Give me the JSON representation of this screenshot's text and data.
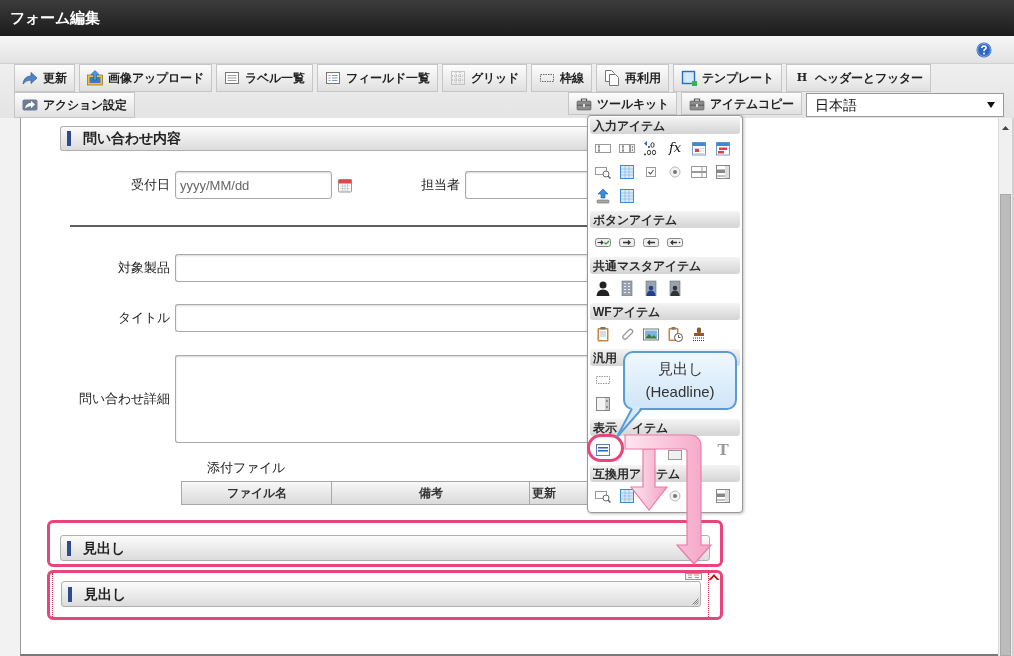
{
  "window": {
    "title": "フォーム編集"
  },
  "toolbar": {
    "row_1": [
      {
        "kind": "update",
        "label": "更新"
      },
      {
        "kind": "upload",
        "label": "画像アップロード"
      },
      {
        "kind": "labels",
        "label": "ラベル一覧"
      },
      {
        "kind": "fields",
        "label": "フィールド一覧"
      },
      {
        "kind": "grid",
        "label": "グリッド"
      },
      {
        "kind": "frame",
        "label": "枠線"
      },
      {
        "kind": "reuse",
        "label": "再利用"
      },
      {
        "kind": "template",
        "label": "テンプレート"
      },
      {
        "kind": "glyph",
        "glyph": "H",
        "label": "ヘッダーとフッター"
      }
    ],
    "row_2_left": [
      {
        "label": "アクション設定"
      }
    ],
    "row_2_right": [
      {
        "label": "ツールキット"
      },
      {
        "label": "アイテムコピー"
      }
    ],
    "language_select": {
      "value": "日本語"
    }
  },
  "form": {
    "section_title": "問い合わせ内容",
    "row_1": [
      {
        "kind": "date",
        "label": "受付日",
        "placeholder": "yyyy/MM/dd"
      },
      {
        "kind": "text",
        "label": "担当者"
      }
    ],
    "fields": [
      {
        "kind": "text",
        "label": "対象製品"
      },
      {
        "kind": "text",
        "label": "タイトル"
      },
      {
        "kind": "textarea",
        "label": "問い合わせ詳細"
      }
    ],
    "attachments": {
      "label": "添付ファイル",
      "columns": [
        "ファイル名",
        "備考",
        "更新"
      ]
    },
    "headlines": [
      {
        "label": "見出し",
        "framed": true,
        "selected": false
      },
      {
        "label": "見出し",
        "framed": true,
        "selected": true
      }
    ]
  },
  "toolkit_palette": {
    "sections": [
      {
        "title_parts": [
          "入力アイテム"
        ],
        "rows": [
          [
            {
              "kind": "text",
              "circled": false
            },
            {
              "kind": "text-button",
              "circled": false
            },
            {
              "kind": "decimal",
              "circled": false
            },
            {
              "kind": "formula",
              "glyph": "fx",
              "circled": false
            },
            {
              "kind": "calendar",
              "circled": false
            },
            {
              "kind": "calendar-range",
              "circled": false
            }
          ],
          [
            {
              "kind": "lookup",
              "circled": false
            },
            {
              "kind": "table",
              "circled": false
            },
            {
              "kind": "checkbox",
              "circled": false
            },
            {
              "kind": "radio",
              "circled": false
            },
            {
              "kind": "select",
              "circled": false
            },
            {
              "kind": "listbox",
              "circled": false
            }
          ],
          [
            {
              "kind": "upload",
              "circled": false
            },
            {
              "kind": "table",
              "circled": false
            }
          ]
        ]
      },
      {
        "title_parts": [
          "ボタンアイテム"
        ],
        "rows": [
          [
            {
              "kind": "button-check",
              "circled": false
            },
            {
              "kind": "button-next",
              "circled": false
            },
            {
              "kind": "button-back",
              "circled": false
            },
            {
              "kind": "button-back-dots",
              "circled": false
            }
          ]
        ]
      },
      {
        "title_parts": [
          "共通マスタアイテム"
        ],
        "rows": [
          [
            {
              "kind": "user",
              "circled": false
            },
            {
              "kind": "building",
              "circled": false
            },
            {
              "kind": "building-user",
              "circled": false
            },
            {
              "kind": "building-person",
              "circled": false
            }
          ]
        ]
      },
      {
        "title_parts": [
          "WFアイテム"
        ],
        "rows": [
          [
            {
              "kind": "clipboard",
              "circled": false
            },
            {
              "kind": "paperclip",
              "circled": false
            },
            {
              "kind": "image",
              "circled": false
            },
            {
              "kind": "clipboard-clock",
              "circled": false
            },
            {
              "kind": "stamp",
              "circled": false
            }
          ]
        ]
      },
      {
        "title_parts": [
          "汎用"
        ],
        "rows": [
          [
            {
              "kind": "dashed-box",
              "circled": false
            }
          ],
          [
            {
              "kind": "panel",
              "circled": false
            }
          ]
        ]
      },
      {
        "title_parts": [
          "表示",
          "イテム"
        ],
        "rows": [
          [
            {
              "kind": "headline",
              "circled": true
            },
            {
              "kind": "covered"
            },
            {
              "kind": "covered"
            },
            {
              "kind": "box",
              "circled": false
            },
            {
              "kind": "covered"
            },
            {
              "kind": "label",
              "glyph": "T",
              "circled": false
            }
          ]
        ]
      },
      {
        "title_parts": [
          "互換用ア",
          "テム"
        ],
        "rows": [
          [
            {
              "kind": "lookup",
              "circled": false
            },
            {
              "kind": "table",
              "circled": false
            },
            {
              "kind": "covered"
            },
            {
              "kind": "radio",
              "circled": false
            },
            {
              "kind": "covered"
            },
            {
              "kind": "listbox",
              "circled": false
            }
          ]
        ]
      }
    ],
    "callout": {
      "lines": [
        "見出し",
        "(Headline)"
      ]
    }
  }
}
